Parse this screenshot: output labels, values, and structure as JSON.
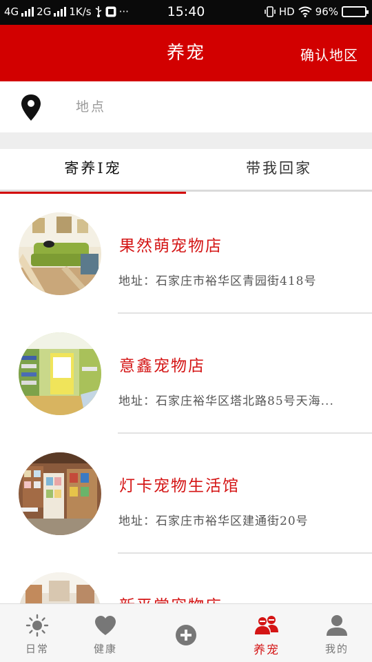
{
  "status_bar": {
    "net1": "4G",
    "net2": "2G",
    "speed": "1K/s",
    "dots": "···",
    "time": "15:40",
    "hd": "HD",
    "battery": "96%",
    "battery_level": 0.96
  },
  "header": {
    "title": "养宠",
    "action": "确认地区"
  },
  "location": {
    "placeholder": "地点",
    "icon": "location-pin-icon"
  },
  "tabs": [
    {
      "label": "寄养I宠",
      "active": true
    },
    {
      "label": "带我回家",
      "active": false
    }
  ],
  "stores": [
    {
      "name": "果然萌宠物店",
      "address": "地址：石家庄市裕华区青园街418号"
    },
    {
      "name": "意鑫宠物店",
      "address": "地址：石家庄裕华区塔北路85号天海..."
    },
    {
      "name": "灯卡宠物生活馆",
      "address": "地址：石家庄市裕华区建通街20号"
    },
    {
      "name": "新平常宠物店",
      "address": ""
    }
  ],
  "nav": [
    {
      "label": "日常",
      "icon": "sun-icon",
      "active": false
    },
    {
      "label": "健康",
      "icon": "heart-icon",
      "active": false
    },
    {
      "label": "",
      "icon": "add-icon",
      "active": false
    },
    {
      "label": "养宠",
      "icon": "people-icon",
      "active": true
    },
    {
      "label": "我的",
      "icon": "user-icon",
      "active": false
    }
  ],
  "colors": {
    "brand": "#d20000",
    "store_name": "#d41515",
    "nav_inactive": "#777777"
  }
}
